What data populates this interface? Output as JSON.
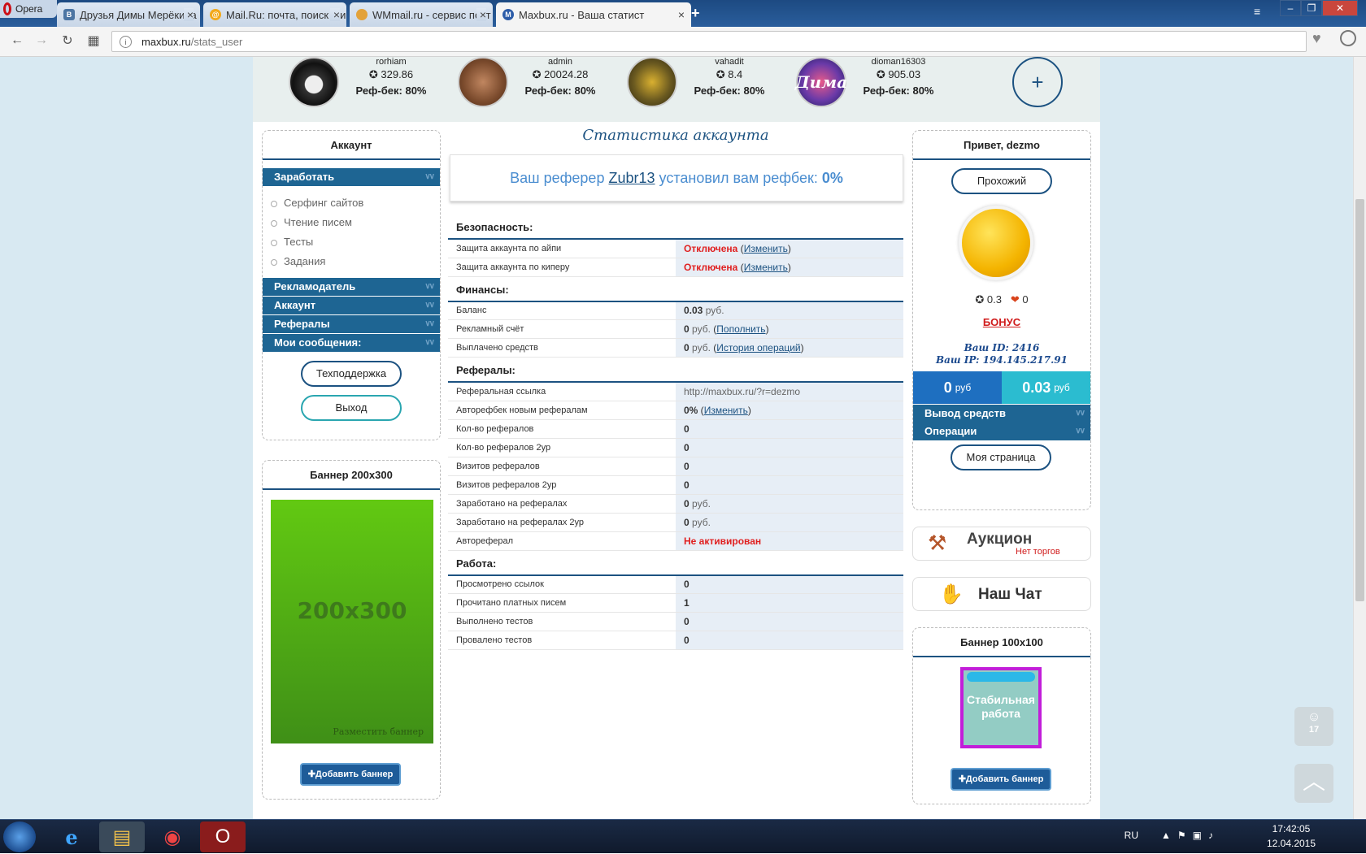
{
  "browser": {
    "opera_label": "Opera",
    "tabs": [
      {
        "label": "Друзья Димы Мерёкина",
        "fav_color": "#4c75a3",
        "fav_glyph": "В"
      },
      {
        "label": "Mail.Ru: почта, поиск в ин",
        "fav_color": "#f3a91a",
        "fav_glyph": "@"
      },
      {
        "label": "WMmail.ru - сервис почт",
        "fav_color": "#e3a23a",
        "fav_glyph": ""
      },
      {
        "label": "Maxbux.ru - Ваша статист",
        "fav_color": "#2c5ca8",
        "fav_glyph": "M"
      }
    ],
    "url_host": "maxbux.ru",
    "url_path": "/stats_user"
  },
  "referrals_strip": [
    {
      "name": "rorhiam",
      "score": "329.86",
      "refback": "Реф-бек: 80%"
    },
    {
      "name": "admin",
      "score": "20024.28",
      "refback": "Реф-бек: 80%"
    },
    {
      "name": "vahadit",
      "score": "8.4",
      "refback": "Реф-бек: 80%"
    },
    {
      "name": "dioman16303",
      "score": "905.03",
      "refback": "Реф-бек: 80%"
    }
  ],
  "left_menu": {
    "title": "Аккаунт",
    "earn": "Заработать",
    "earn_items": [
      "Серфинг сайтов",
      "Чтение писем",
      "Тесты",
      "Задания"
    ],
    "sections": [
      "Рекламодатель",
      "Аккаунт",
      "Рефералы",
      "Мои сообщения:"
    ],
    "support": "Техподдержка",
    "logout": "Выход"
  },
  "banner200": {
    "title": "Баннер 200x300",
    "ad_text": "200x300",
    "ad_sub": "Разместить баннер",
    "add_btn": "Добавить баннер"
  },
  "stats": {
    "title": "Статистика аккаунта",
    "referrer_prefix": "Ваш реферер",
    "referrer_name": "Zubr13",
    "referrer_mid": "установил вам рефбек:",
    "referrer_value": "0%",
    "security": {
      "title": "Безопасность:",
      "rows": [
        {
          "label": "Защита аккаунта по айпи",
          "status": "Отключена",
          "link": "Изменить"
        },
        {
          "label": "Защита аккаунта по киперу",
          "status": "Отключена",
          "link": "Изменить"
        }
      ]
    },
    "finance": {
      "title": "Финансы:",
      "rows": [
        {
          "label": "Баланс",
          "value": "0.03",
          "unit": "руб.",
          "link": ""
        },
        {
          "label": "Рекламный счёт",
          "value": "0",
          "unit": "руб.",
          "link": "Пополнить"
        },
        {
          "label": "Выплачено средств",
          "value": "0",
          "unit": "руб.",
          "link": "История операций"
        }
      ]
    },
    "referrals": {
      "title": "Рефералы:",
      "ref_link_label": "Реферальная ссылка",
      "ref_link": "http://maxbux.ru/?r=dezmo",
      "autorefback_label": "Авторефбек новым рефералам",
      "autorefback_value": "0%",
      "autorefback_link": "Изменить",
      "rows": [
        {
          "label": "Кол-во рефералов",
          "value": "0",
          "unit": ""
        },
        {
          "label": "Кол-во рефералов 2ур",
          "value": "0",
          "unit": ""
        },
        {
          "label": "Визитов рефералов",
          "value": "0",
          "unit": ""
        },
        {
          "label": "Визитов рефералов 2ур",
          "value": "0",
          "unit": ""
        },
        {
          "label": "Заработано на рефералах",
          "value": "0",
          "unit": "руб."
        },
        {
          "label": "Заработано на рефералах 2ур",
          "value": "0",
          "unit": "руб."
        }
      ],
      "autoref_label": "Автореферал",
      "autoref_value": "Не активирован"
    },
    "work": {
      "title": "Работа:",
      "rows": [
        {
          "label": "Просмотрено ссылок",
          "value": "0"
        },
        {
          "label": "Прочитано платных писем",
          "value": "1"
        },
        {
          "label": "Выполнено тестов",
          "value": "0"
        },
        {
          "label": "Провалено тестов",
          "value": "0"
        }
      ]
    }
  },
  "profile": {
    "greeting": "Привет, dezmo",
    "status": "Прохожий",
    "rating": "0.3",
    "likes": "0",
    "bonus": "БОНУС",
    "id_line": "Ваш ID: 2416",
    "ip_line": "Ваш IP: 194.145.217.91",
    "balance_main": "0",
    "balance_ad": "0.03",
    "currency": "руб",
    "withdraw": "Вывод средств",
    "operations": "Операции",
    "my_page": "Моя страница"
  },
  "auction": {
    "title": "Аукцион",
    "sub": "Нет торгов"
  },
  "chat": {
    "title": "Наш Чат"
  },
  "banner100": {
    "title": "Баннер 100x100",
    "ad_text": "Стабильная работа",
    "add_btn": "Добавить баннер"
  },
  "float_counter": "17",
  "taskbar": {
    "lang": "RU",
    "time": "17:42:05",
    "date": "12.04.2015"
  }
}
